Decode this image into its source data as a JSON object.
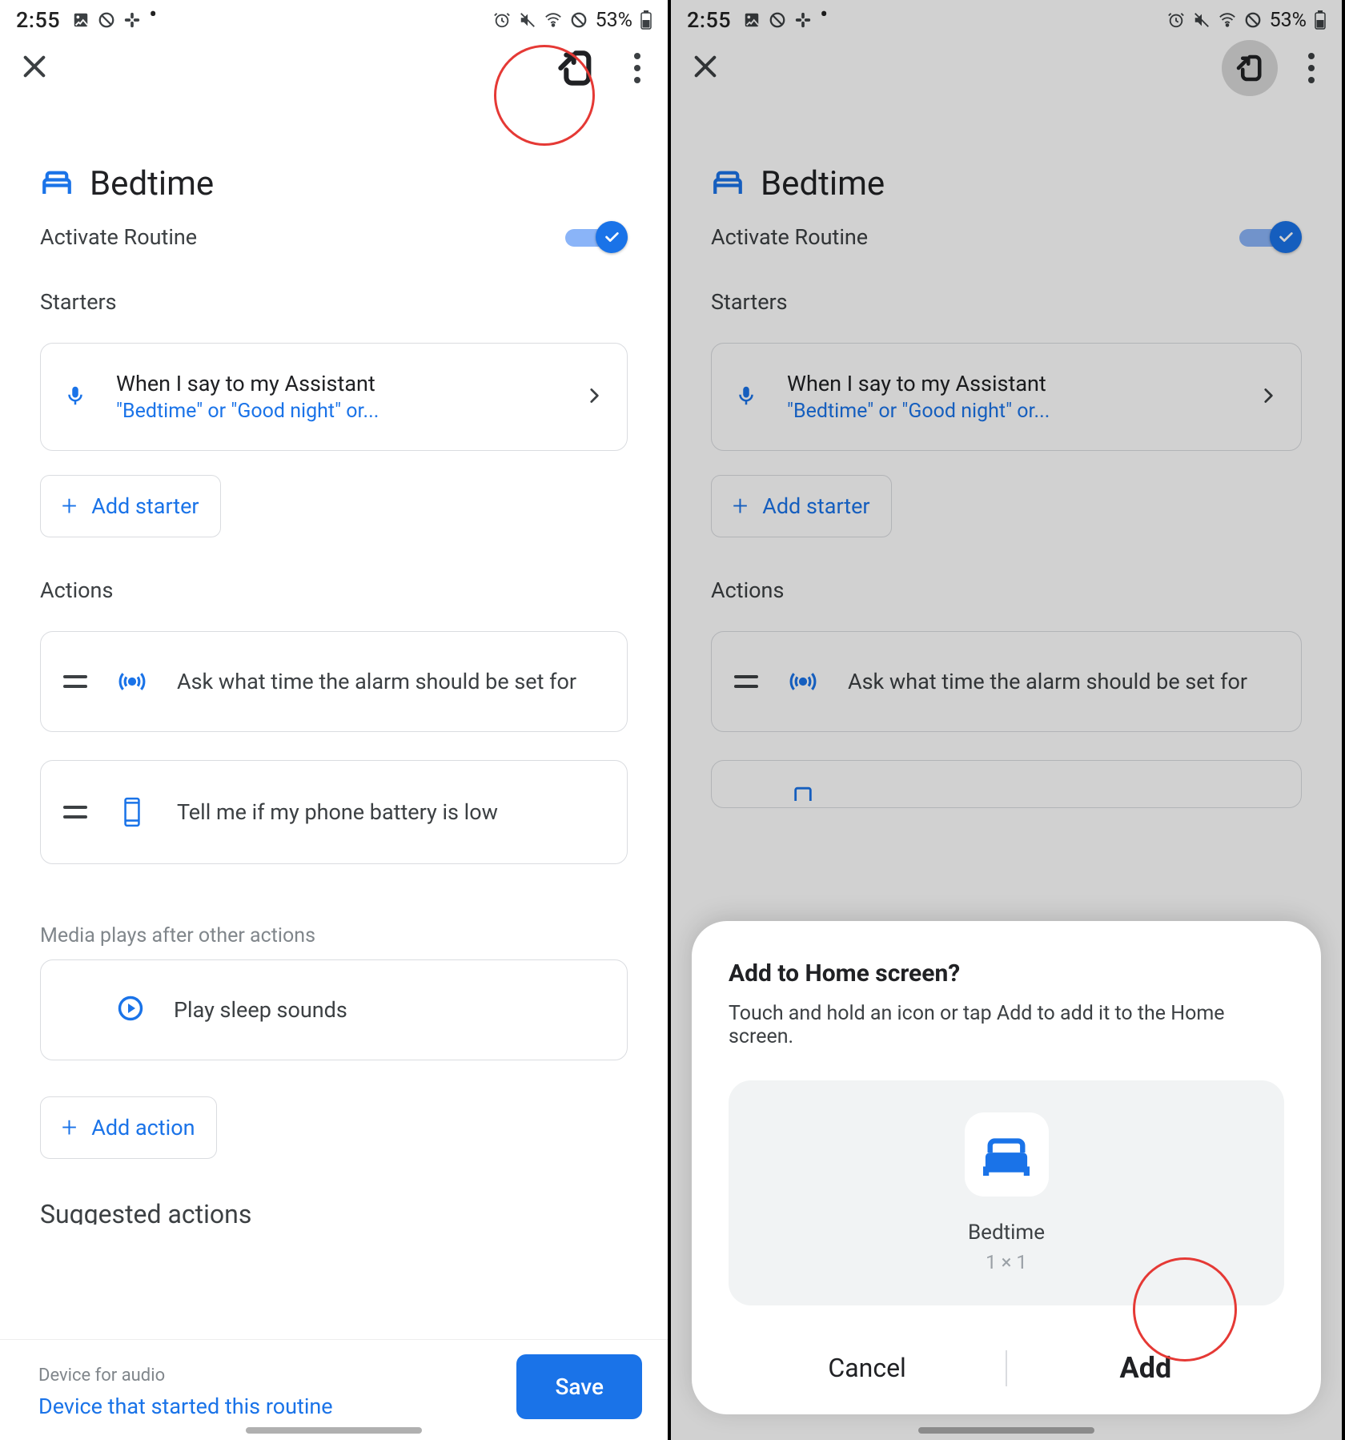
{
  "status": {
    "time": "2:55",
    "battery": "53%"
  },
  "appbar": {
    "close": "✕"
  },
  "routine": {
    "title": "Bedtime",
    "activate_label": "Activate Routine",
    "starters_label": "Starters",
    "starter": {
      "line1": "When I say to my Assistant",
      "line2": "\"Bedtime\" or \"Good night\" or..."
    },
    "add_starter": "Add starter",
    "actions_label": "Actions",
    "action1": "Ask what time the alarm should be set for",
    "action2": "Tell me if my phone battery is low",
    "media_label": "Media plays after other actions",
    "media_action": "Play sleep sounds",
    "add_action": "Add action",
    "suggested": "Suggested actions"
  },
  "footer": {
    "device_label": "Device for audio",
    "device_value": "Device that started this routine",
    "save": "Save"
  },
  "dialog": {
    "title": "Add to Home screen?",
    "body": "Touch and hold an icon or tap Add to add it to the Home screen.",
    "preview_title": "Bedtime",
    "preview_dim": "1 × 1",
    "cancel": "Cancel",
    "add": "Add"
  }
}
